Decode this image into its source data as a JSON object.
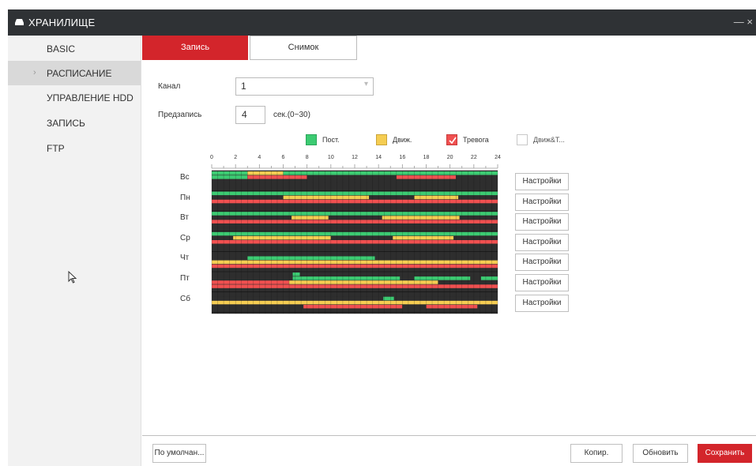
{
  "title": "ХРАНИЛИЩЕ",
  "close_label": "— ×",
  "sidebar": {
    "items": [
      {
        "label": "BASIC"
      },
      {
        "label": "РАСПИСАНИЕ",
        "active": true
      },
      {
        "label": "УПРАВЛЕНИЕ HDD"
      },
      {
        "label": "ЗАПИСЬ"
      },
      {
        "label": "FTP"
      }
    ]
  },
  "tabs": {
    "record": "Запись",
    "snapshot": "Снимок"
  },
  "channel": {
    "label": "Канал",
    "value": "1"
  },
  "prerecord": {
    "label": "Предзапись",
    "value": "4",
    "unit": "сек.(0~30)"
  },
  "legend": [
    {
      "label": "Пост.",
      "color": "#3ccb72"
    },
    {
      "label": "Движ.",
      "color": "#f5cd52"
    },
    {
      "label": "Тревога",
      "color": "#f05050"
    },
    {
      "label": "Движ&Т...",
      "color": "#ffffff"
    }
  ],
  "hours": [
    "0",
    "2",
    "4",
    "6",
    "8",
    "10",
    "12",
    "14",
    "16",
    "18",
    "20",
    "22",
    "24"
  ],
  "colors": {
    "green": "#3ccb72",
    "yellow": "#f5cd52",
    "red": "#f05050",
    "empty": "#2e2e2e",
    "accent": "#d3252b"
  },
  "days": [
    {
      "label": "Вс",
      "rows": [
        [
          [
            "green",
            0,
            3
          ],
          [
            "yellow",
            3,
            6
          ],
          [
            "green",
            6,
            24
          ]
        ],
        [
          [
            "green",
            0,
            3
          ],
          [
            "red",
            3,
            8
          ],
          [
            "empty",
            8,
            15.5
          ],
          [
            "red",
            15.5,
            20.5
          ],
          [
            "empty",
            20.5,
            24
          ]
        ],
        [
          [
            "empty",
            0,
            24
          ]
        ]
      ]
    },
    {
      "label": "Пн",
      "rows": [
        [
          [
            "green",
            0,
            24
          ]
        ],
        [
          [
            "empty",
            0,
            6
          ],
          [
            "yellow",
            6,
            13.2
          ],
          [
            "empty",
            13.2,
            17
          ],
          [
            "yellow",
            17,
            20.7
          ],
          [
            "empty",
            20.7,
            24
          ]
        ],
        [
          [
            "red",
            0,
            24
          ]
        ]
      ]
    },
    {
      "label": "Вт",
      "rows": [
        [
          [
            "green",
            0,
            24
          ]
        ],
        [
          [
            "empty",
            0,
            6.7
          ],
          [
            "yellow",
            6.7,
            9.8
          ],
          [
            "empty",
            9.8,
            14.3
          ],
          [
            "yellow",
            14.3,
            20.8
          ],
          [
            "empty",
            20.8,
            24
          ]
        ],
        [
          [
            "red",
            0,
            24
          ]
        ]
      ]
    },
    {
      "label": "Ср",
      "rows": [
        [
          [
            "green",
            0,
            24
          ]
        ],
        [
          [
            "empty",
            0,
            1.8
          ],
          [
            "yellow",
            1.8,
            10
          ],
          [
            "empty",
            10,
            15.2
          ],
          [
            "yellow",
            15.2,
            20.3
          ],
          [
            "empty",
            20.3,
            24
          ]
        ],
        [
          [
            "red",
            0,
            24
          ]
        ]
      ]
    },
    {
      "label": "Чт",
      "rows": [
        [
          [
            "empty",
            0,
            24
          ]
        ],
        [
          [
            "empty",
            0,
            3
          ],
          [
            "green",
            3,
            13.7
          ],
          [
            "empty",
            13.7,
            24
          ]
        ],
        [
          [
            "yellow",
            0,
            24
          ]
        ],
        [
          [
            "red",
            0,
            24
          ]
        ]
      ]
    },
    {
      "label": "Пт",
      "rows": [
        [
          [
            "empty",
            0,
            6.8
          ],
          [
            "green",
            6.8,
            7.4
          ],
          [
            "empty",
            7.4,
            24
          ]
        ],
        [
          [
            "empty",
            0,
            6.8
          ],
          [
            "green",
            6.8,
            15.8
          ],
          [
            "empty",
            15.8,
            17
          ],
          [
            "green",
            17,
            21.7
          ],
          [
            "empty",
            21.7,
            22.6
          ],
          [
            "green",
            22.6,
            24
          ]
        ],
        [
          [
            "red",
            0,
            6.5
          ],
          [
            "yellow",
            6.5,
            19
          ],
          [
            "empty",
            19,
            24
          ]
        ],
        [
          [
            "red",
            0,
            24
          ]
        ]
      ]
    },
    {
      "label": "Сб",
      "rows": [
        [
          [
            "empty",
            0,
            24
          ]
        ],
        [
          [
            "empty",
            0,
            14.4
          ],
          [
            "green",
            14.4,
            15.3
          ],
          [
            "empty",
            15.3,
            24
          ]
        ],
        [
          [
            "yellow",
            0,
            24
          ]
        ],
        [
          [
            "empty",
            0,
            7.7
          ],
          [
            "red",
            7.7,
            16
          ],
          [
            "empty",
            16,
            18
          ],
          [
            "red",
            18,
            22.3
          ],
          [
            "empty",
            22.3,
            24
          ]
        ],
        [
          [
            "empty",
            0,
            24
          ]
        ]
      ]
    }
  ],
  "settings_label": "Настройки",
  "footer": {
    "default": "По умолчан...",
    "copy": "Копир.",
    "refresh": "Обновить",
    "save": "Сохранить"
  }
}
